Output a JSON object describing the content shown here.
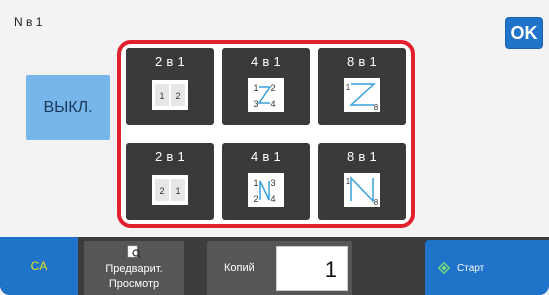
{
  "header": {
    "title": "N в 1",
    "ok_label": "OK"
  },
  "off_button": {
    "label": "ВЫКЛ."
  },
  "options": [
    {
      "label": "2 в 1",
      "icon": "layout-2in1-ltr-icon"
    },
    {
      "label": "4 в 1",
      "icon": "layout-4in1-z-icon"
    },
    {
      "label": "8 в 1",
      "icon": "layout-8in1-z-icon"
    },
    {
      "label": "2 в 1",
      "icon": "layout-2in1-rtl-icon"
    },
    {
      "label": "4 в 1",
      "icon": "layout-4in1-n-icon"
    },
    {
      "label": "8 в 1",
      "icon": "layout-8in1-n-icon"
    }
  ],
  "footer": {
    "ca_label": "CA",
    "preview_line1": "Предварит.",
    "preview_line2": "Просмотр",
    "copies_label": "Копий",
    "copies_value": "1",
    "start_label": "Старт"
  },
  "colors": {
    "accent": "#1f73c9",
    "selection": "#e2202e",
    "off_button": "#77b6ea",
    "tile": "#3a3a3a",
    "ca_text": "#e8e21a"
  }
}
